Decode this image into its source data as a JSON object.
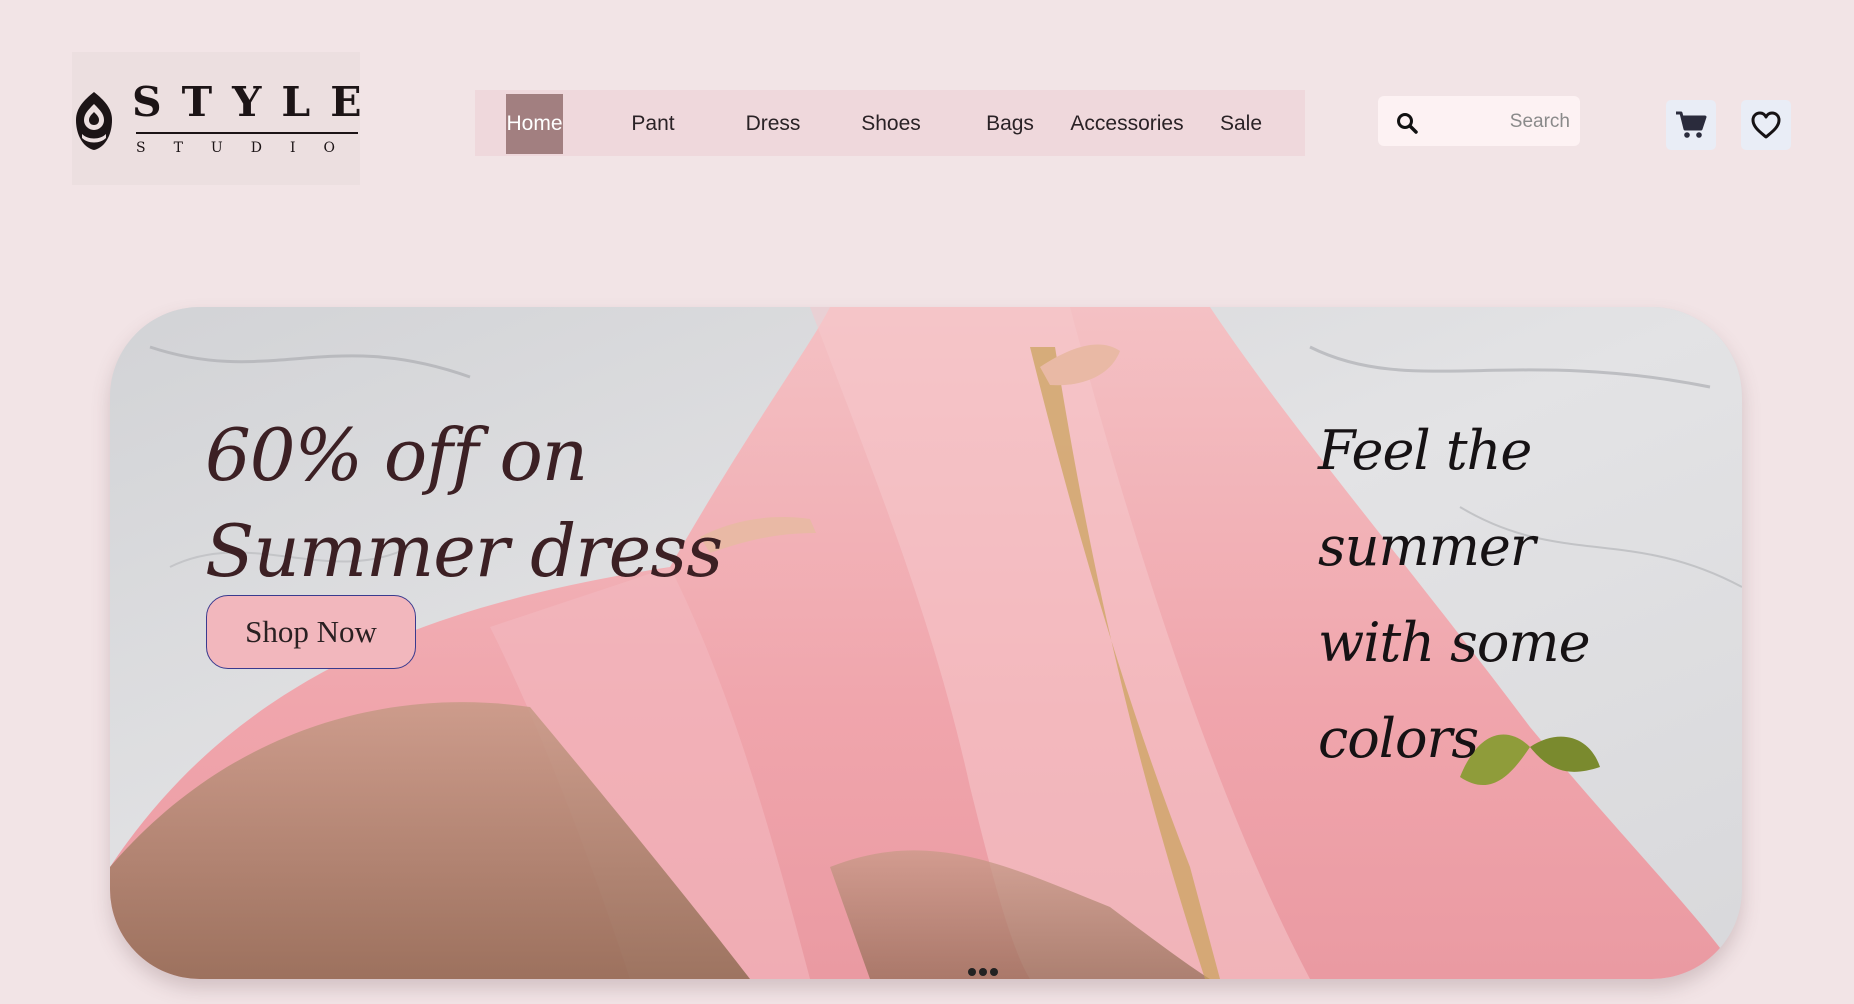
{
  "brand": {
    "name": "STYLE",
    "subtitle": "STUDIO"
  },
  "nav": {
    "items": [
      {
        "label": "Home",
        "active": true
      },
      {
        "label": "Pant",
        "active": false
      },
      {
        "label": "Dress",
        "active": false
      },
      {
        "label": "Shoes",
        "active": false
      },
      {
        "label": "Bags",
        "active": false
      },
      {
        "label": "Accessories",
        "active": false
      },
      {
        "label": "Sale",
        "active": false
      }
    ]
  },
  "search": {
    "placeholder": "Search",
    "icon": "search-icon"
  },
  "actions": {
    "cart_icon": "cart-icon",
    "wishlist_icon": "heart-icon"
  },
  "hero": {
    "headline_line1": "60% off on",
    "headline_line2": "Summer dress",
    "cta_label": "Shop Now",
    "tagline_line1": "Feel the summer",
    "tagline_line2": "with some colors",
    "slide_count": 3
  },
  "colors": {
    "page_bg": "#f2e4e6",
    "nav_bg": "#efd8dc",
    "nav_active": "#a27f80",
    "cta_bg": "#f2b7bd",
    "cta_border": "#3a3a8e",
    "headline": "#3c2024",
    "dress_pink": "#f0a7ad"
  }
}
